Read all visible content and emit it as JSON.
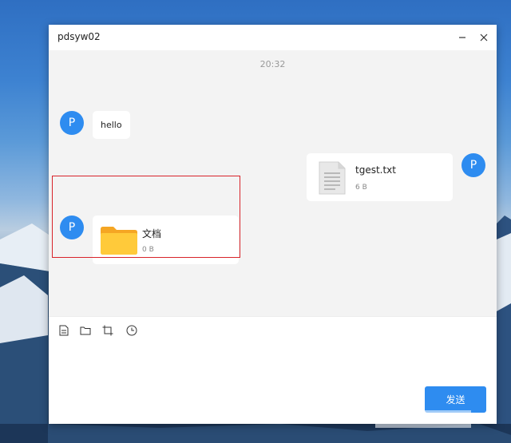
{
  "window": {
    "title": "pdsyw02"
  },
  "chat": {
    "timestamp": "20:32",
    "messages": [
      {
        "avatar": "P",
        "text": "hello"
      },
      {
        "avatar": "P",
        "file_name": "tgest.txt",
        "file_size": "6 B"
      },
      {
        "avatar": "P",
        "file_name": "文档",
        "file_size": "0 B"
      }
    ]
  },
  "toolbar": {
    "icons": [
      "file-icon",
      "folder-icon",
      "crop-icon",
      "clock-icon"
    ]
  },
  "input": {
    "value": ""
  },
  "actions": {
    "send_label": "发送"
  },
  "colors": {
    "accent": "#2e8cf0",
    "highlight": "#d8232a"
  }
}
